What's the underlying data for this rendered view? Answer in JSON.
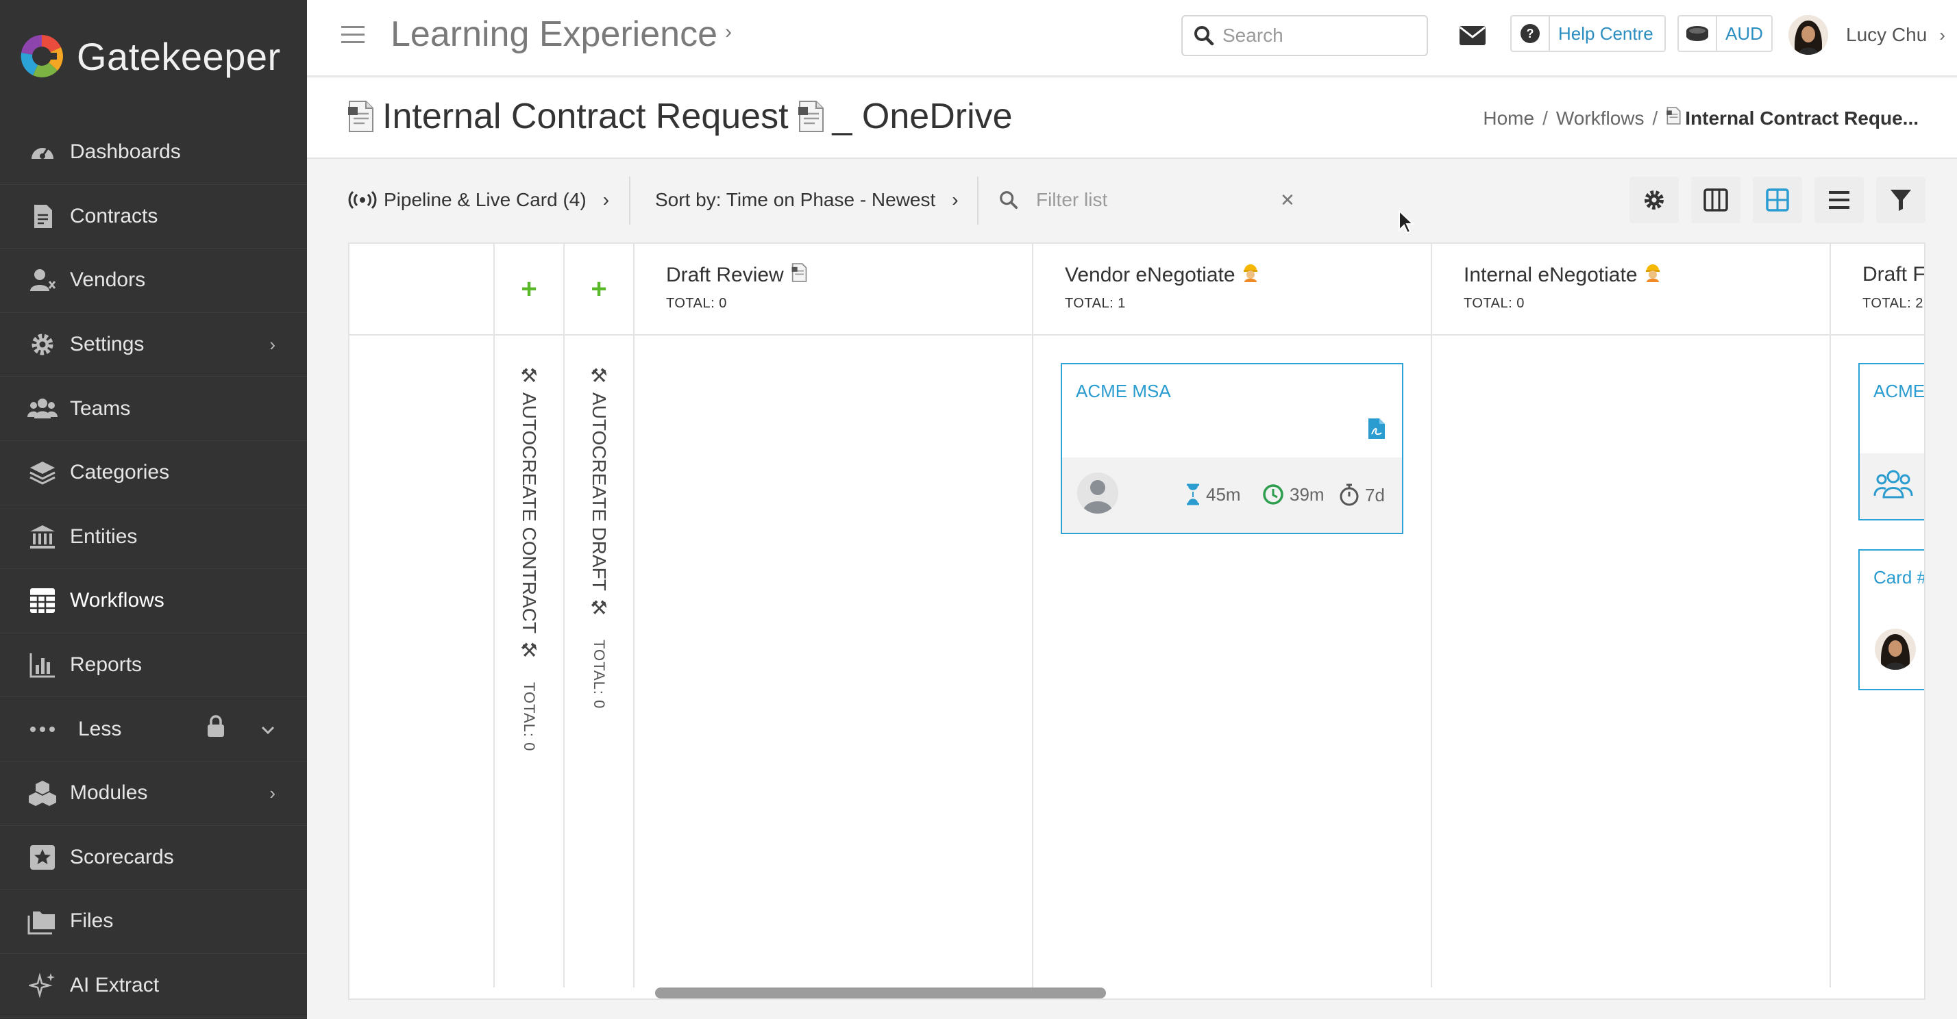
{
  "brand": {
    "name": "Gatekeeper"
  },
  "sidebar": {
    "items": [
      {
        "label": "Dashboards",
        "icon": "dashboard-gauge-icon"
      },
      {
        "label": "Contracts",
        "icon": "contract-document-icon"
      },
      {
        "label": "Vendors",
        "icon": "vendors-icon"
      },
      {
        "label": "Settings",
        "icon": "gear-icon"
      },
      {
        "label": "Teams",
        "icon": "teams-icon"
      },
      {
        "label": "Categories",
        "icon": "layers-icon"
      },
      {
        "label": "Entities",
        "icon": "bank-building-icon"
      },
      {
        "label": "Workflows",
        "icon": "workflow-grid-icon"
      },
      {
        "label": "Reports",
        "icon": "bar-chart-icon"
      },
      {
        "label": "Less",
        "icon": "ellipsis-icon"
      },
      {
        "label": "Modules",
        "icon": "cubes-icon"
      },
      {
        "label": "Scorecards",
        "icon": "star-badge-icon"
      },
      {
        "label": "Files",
        "icon": "folders-icon"
      },
      {
        "label": "AI Extract",
        "icon": "sparkles-icon"
      }
    ],
    "active": "Workflows"
  },
  "topbar": {
    "app_title": "Learning Experience",
    "search_placeholder": "Search",
    "help_label": "Help Centre",
    "currency_label": "AUD",
    "user_name": "Lucy Chu"
  },
  "page": {
    "title_prefix": "Internal Contract Request",
    "title_suffix": "_ OneDrive",
    "breadcrumb": {
      "home": "Home",
      "workflows": "Workflows",
      "current": "Internal Contract Reque..."
    }
  },
  "toolbar": {
    "pipeline_label": "Pipeline & Live Card (4)",
    "sort_label": "Sort by: Time on Phase - Newest",
    "filter_placeholder": "Filter list"
  },
  "board": {
    "autocreate_contract": {
      "label": "AUTOCREATE CONTRACT",
      "total": "TOTAL: 0"
    },
    "autocreate_draft": {
      "label": "AUTOCREATE DRAFT",
      "total": "TOTAL: 0"
    },
    "columns": [
      {
        "name": "Draft Review",
        "total": "TOTAL: 0"
      },
      {
        "name": "Vendor eNegotiate",
        "total": "TOTAL: 1"
      },
      {
        "name": "Internal eNegotiate",
        "total": "TOTAL: 0"
      },
      {
        "name": "Draft F",
        "total": "TOTAL: 2"
      }
    ],
    "cards": {
      "acme_msa": {
        "title": "ACME MSA",
        "m1": "45m",
        "m2": "39m",
        "m3": "7d"
      },
      "acme_partial": {
        "title": "ACME"
      },
      "card_partial": {
        "title": "Card #"
      }
    }
  },
  "colors": {
    "accent": "#2b9cd0",
    "plus": "#5ab82a",
    "sidebar": "#333333"
  }
}
